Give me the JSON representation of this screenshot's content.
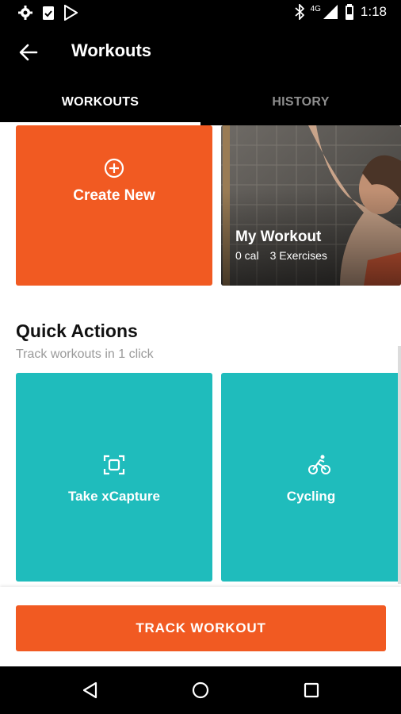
{
  "status_bar": {
    "time": "1:18",
    "network": "4G",
    "icons": [
      "settings-icon",
      "clipboard-check-icon",
      "play-store-icon",
      "bluetooth-icon",
      "signal-icon",
      "battery-icon"
    ]
  },
  "app_bar": {
    "title": "Workouts",
    "back_icon": "arrow-left-icon"
  },
  "tabs": [
    {
      "label": "WORKOUTS",
      "active": true
    },
    {
      "label": "HISTORY",
      "active": false
    }
  ],
  "workouts": {
    "create_new": {
      "label": "Create New",
      "icon": "plus-circle-icon"
    },
    "my_workout": {
      "title": "My Workout",
      "calories": "0 cal",
      "exercises": "3 Exercises"
    }
  },
  "quick_actions": {
    "title": "Quick Actions",
    "subtitle": "Track workouts in 1 click",
    "items": [
      {
        "label": "Take xCapture",
        "icon": "scan-icon"
      },
      {
        "label": "Cycling",
        "icon": "cycling-icon"
      }
    ]
  },
  "footer": {
    "track_button": "TRACK WORKOUT"
  },
  "colors": {
    "accent_orange": "#f15a22",
    "teal": "#1fbcbc",
    "app_bar": "#000000"
  }
}
